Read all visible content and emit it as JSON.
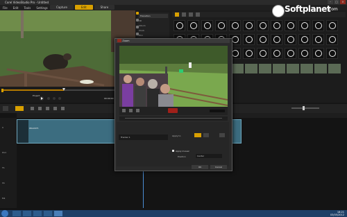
{
  "app": {
    "title": "Corel VideoStudio Pro - Untitled",
    "menus": [
      "File",
      "Edit",
      "Tools",
      "Settings"
    ],
    "steps": [
      {
        "label": "Capture",
        "active": false
      },
      {
        "label": "Edit",
        "active": true
      },
      {
        "label": "Share",
        "active": false
      }
    ]
  },
  "player": {
    "mode_label": "Project",
    "timecode": "00:00:00"
  },
  "library": {
    "category": "Transition",
    "folders": [
      "3D",
      "Album",
      "Clock",
      "Film",
      "Flash"
    ]
  },
  "dialog": {
    "title": "Pan Zoom",
    "checkbox_label": "Show tracking path",
    "track_label": "Tracker 1",
    "mode_label": "Apply to",
    "option_label": "Apply mosaic",
    "position_label": "Position",
    "position_value": "Center",
    "ok_label": "OK",
    "cancel_label": "Cancel"
  },
  "timeline": {
    "clip_name": "IMG4675",
    "tracks": [
      "V",
      "Ov1",
      "T1",
      "V1",
      "M1"
    ]
  },
  "taskbar": {
    "time": "18:21",
    "date": "03/05/2012"
  },
  "watermark": {
    "brand": "Soft",
    "brand2": "planet",
    "suffix": ".com"
  },
  "colors": {
    "accent": "#d9a000",
    "clip": "#3c6d80",
    "taskbar": "#1d3f66"
  }
}
